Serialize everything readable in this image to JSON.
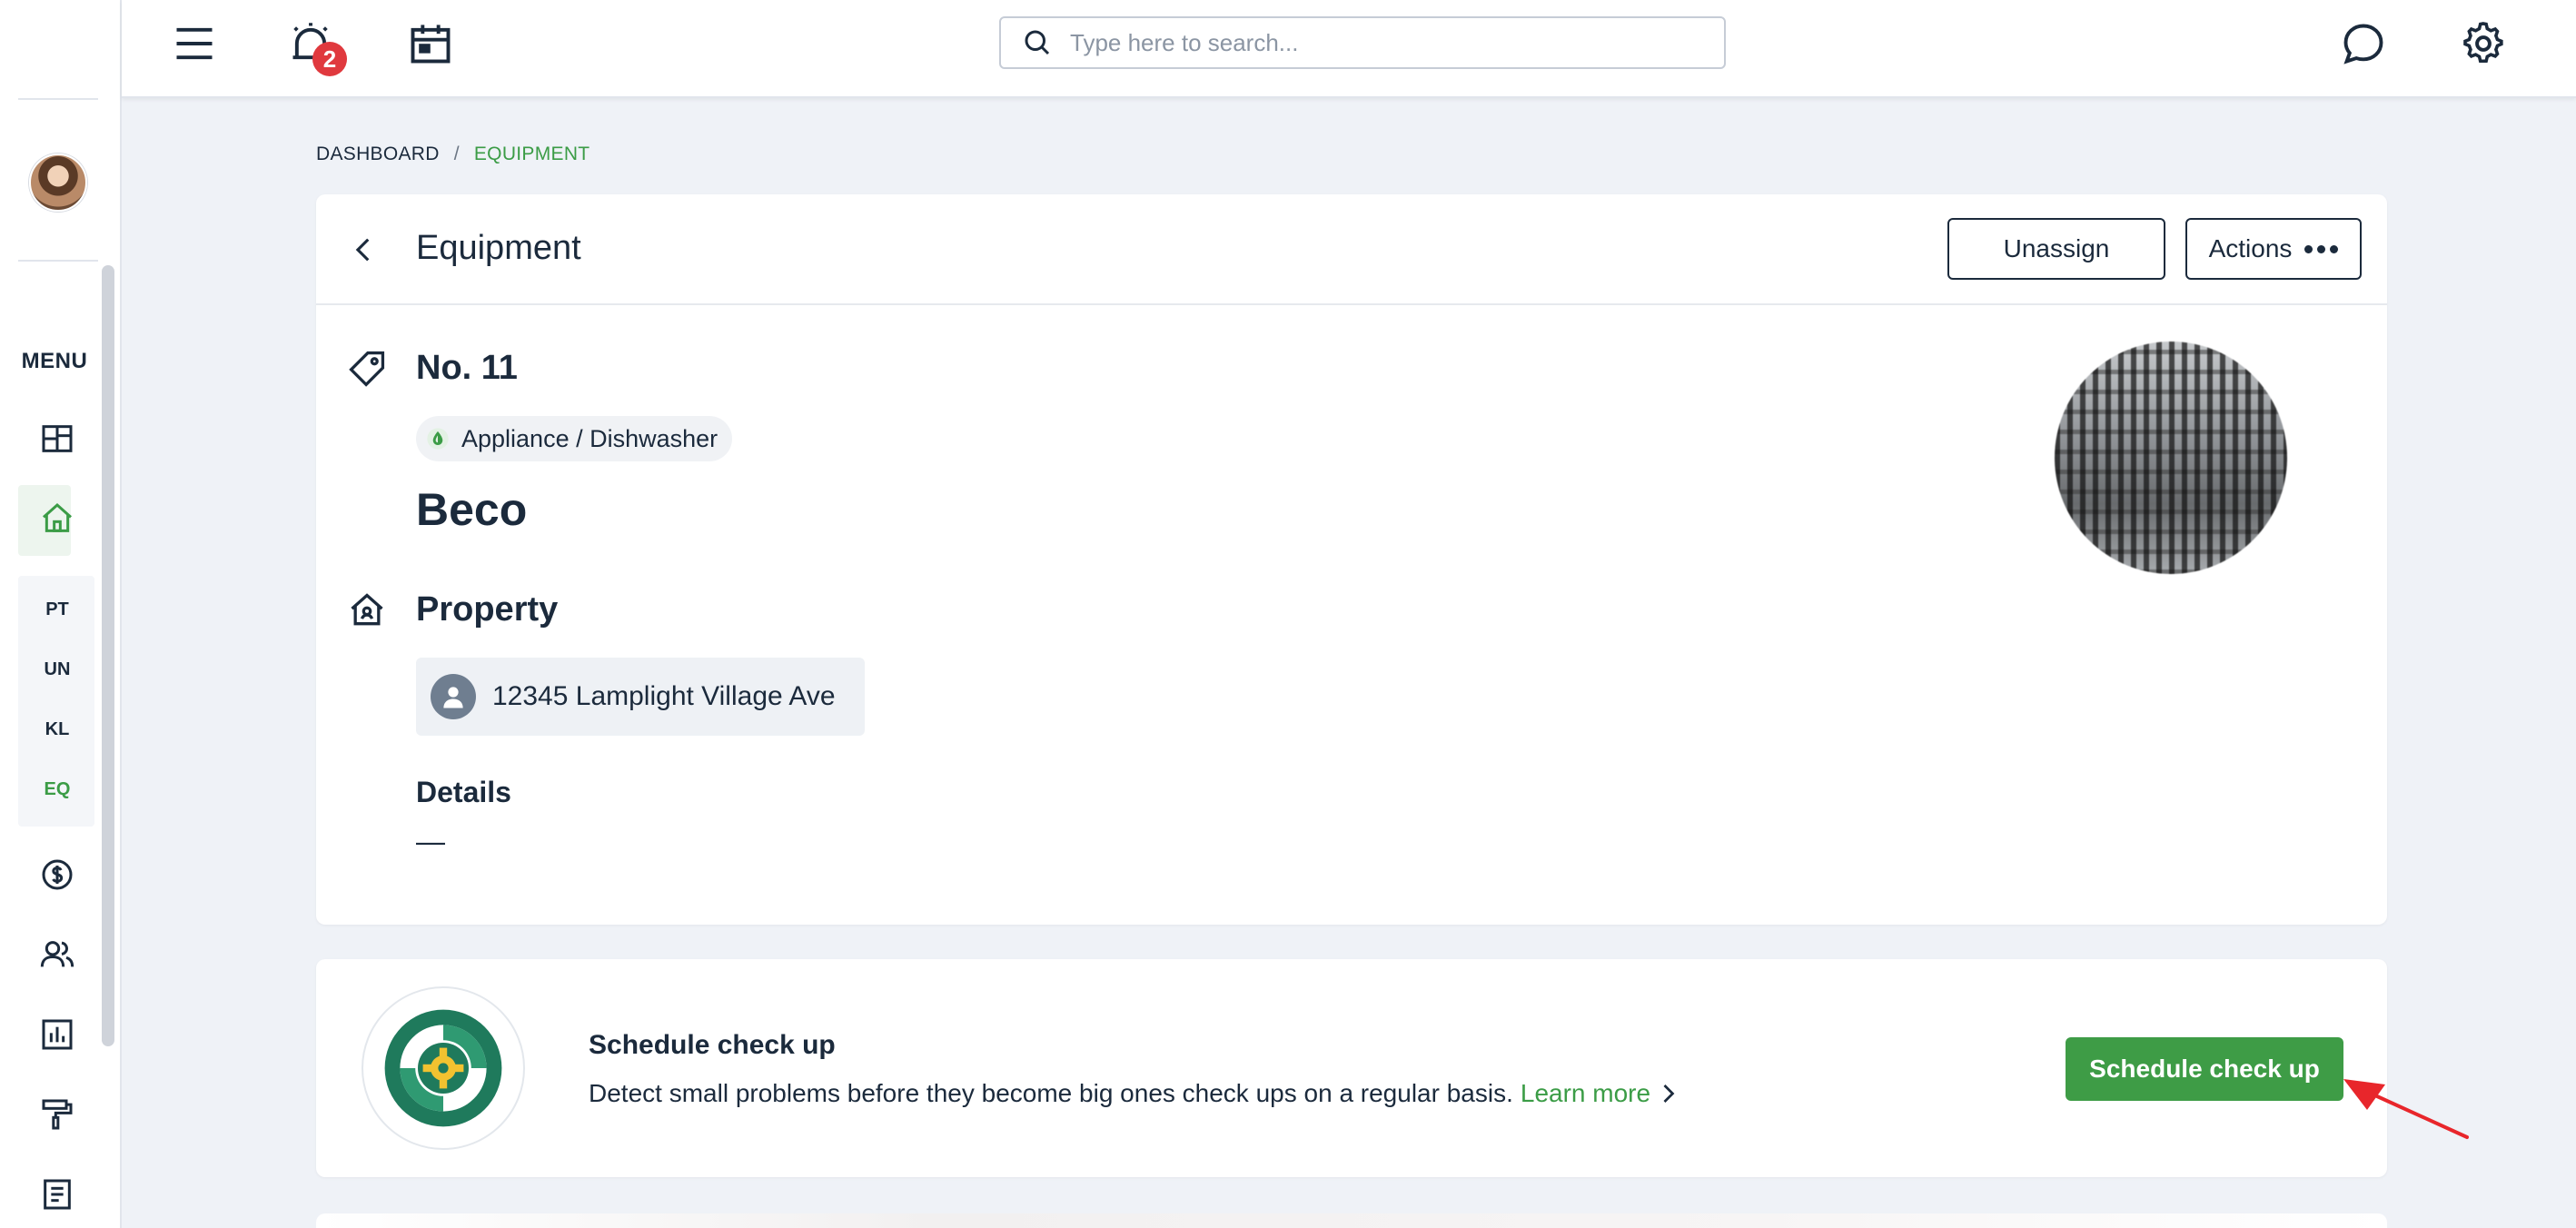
{
  "topbar": {
    "notification_count": "2",
    "search_placeholder": "Type here to search..."
  },
  "sidebar": {
    "menu_label": "MENU",
    "sub_items": [
      "PT",
      "UN",
      "KL",
      "EQ"
    ],
    "active_sub_item": "EQ"
  },
  "breadcrumb": {
    "root": "DASHBOARD",
    "separator": "/",
    "current": "EQUIPMENT"
  },
  "equipment_card": {
    "title": "Equipment",
    "unassign_label": "Unassign",
    "actions_label": "Actions",
    "number": "No. 11",
    "category": "Appliance / Dishwasher",
    "name": "Beco",
    "property_heading": "Property",
    "property_address": "12345 Lamplight Village Ave",
    "details_heading": "Details",
    "details_value": "—"
  },
  "schedule_card": {
    "title": "Schedule check up",
    "description": "Detect small problems before they become big ones check ups on a regular basis.",
    "learn_more": "Learn more",
    "button_label": "Schedule check up"
  },
  "colors": {
    "accent_green": "#3e9c46",
    "text_dark": "#1b2a3c",
    "badge_red": "#e0393e",
    "annotation_red": "#e8262b"
  }
}
